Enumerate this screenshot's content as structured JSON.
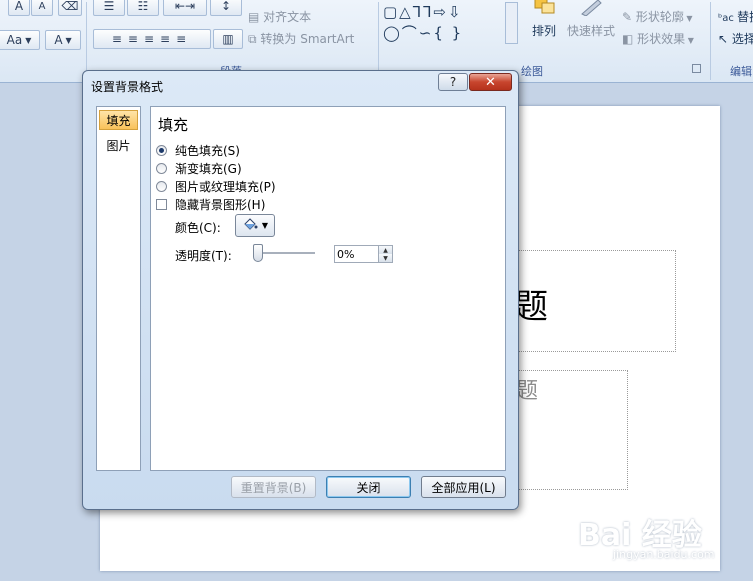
{
  "ribbon": {
    "para_group_label": "段落",
    "draw_group_label": "绘图",
    "edit_group_label": "编辑",
    "align_text": "对齐文本",
    "convert_smartart": "转换为 SmartArt",
    "arrange": "排列",
    "quick_styles": "快速样式",
    "shape_outline": "形状轮廓",
    "shape_effects": "形状效果",
    "replace": "替换",
    "select": "选择",
    "font_size_aa": "Aa",
    "font_grow": "A",
    "font_shrink": "A",
    "font_color": "A",
    "shapes_row1": "▢△⅂⅂⇨⇩",
    "shapes_row2": "◯⌒∽{ }"
  },
  "slide": {
    "title_fragment": "题",
    "subtitle_fragment": "题"
  },
  "watermark": {
    "brand": "Bai 经验",
    "url": "jingyan.baidu.com"
  },
  "dialog": {
    "title": "设置背景格式",
    "help_label": "?",
    "close_label": "✕",
    "nav": [
      {
        "label": "填充",
        "active": true
      },
      {
        "label": "图片",
        "active": false
      }
    ],
    "section_title": "填充",
    "options": [
      {
        "label": "纯色填充(S)",
        "checked": true
      },
      {
        "label": "渐变填充(G)",
        "checked": false
      },
      {
        "label": "图片或纹理填充(P)",
        "checked": false
      }
    ],
    "hide_bg_graphics": "隐藏背景图形(H)",
    "color_label": "颜色(C):",
    "transparency_label": "透明度(T):",
    "transparency_value": "0%",
    "reset_button": "重置背景(B)",
    "close_button": "关闭",
    "apply_all_button": "全部应用(L)"
  }
}
